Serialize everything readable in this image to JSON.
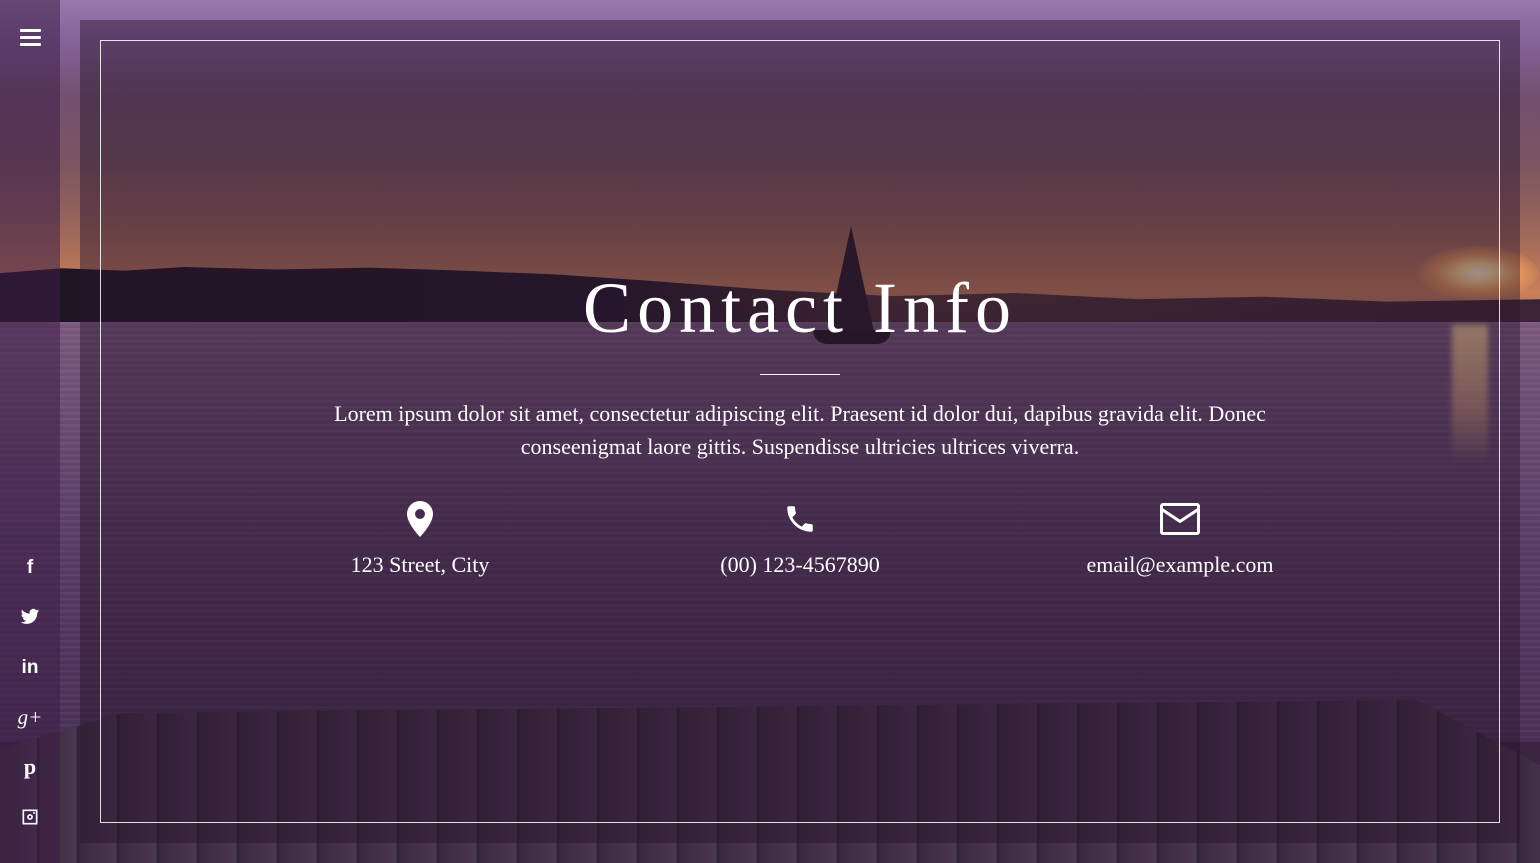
{
  "page": {
    "title": "Contact Info",
    "description": "Lorem ipsum dolor sit amet, consectetur adipiscing elit. Praesent id dolor dui, dapibus gravida elit. Donec conseenigmat laore gittis. Suspendisse ultricies ultrices viverra."
  },
  "sidebar": {
    "menu_icon": "hamburger-icon",
    "social": [
      {
        "name": "facebook",
        "icon": "facebook-icon",
        "glyph": "f"
      },
      {
        "name": "twitter",
        "icon": "twitter-icon"
      },
      {
        "name": "linkedin",
        "icon": "linkedin-icon",
        "glyph": "in"
      },
      {
        "name": "google-plus",
        "icon": "google-plus-icon",
        "glyph": "g+"
      },
      {
        "name": "pinterest",
        "icon": "pinterest-icon",
        "glyph": "p"
      },
      {
        "name": "instagram",
        "icon": "instagram-icon"
      }
    ]
  },
  "contact": {
    "address": {
      "icon": "map-marker-icon",
      "value": "123 Street, City"
    },
    "phone": {
      "icon": "phone-icon",
      "value": "(00) 123-4567890"
    },
    "email": {
      "icon": "envelope-icon",
      "value": "email@example.com"
    }
  },
  "colors": {
    "text": "#ffffff",
    "overlay": "#2a1430",
    "sky_top": "#9a78ad",
    "sunset": "#c9805a"
  }
}
